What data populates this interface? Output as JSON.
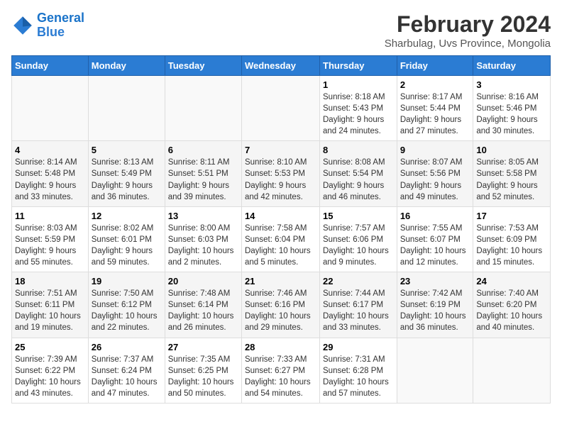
{
  "header": {
    "logo_line1": "General",
    "logo_line2": "Blue",
    "month_year": "February 2024",
    "location": "Sharbulag, Uvs Province, Mongolia"
  },
  "days_of_week": [
    "Sunday",
    "Monday",
    "Tuesday",
    "Wednesday",
    "Thursday",
    "Friday",
    "Saturday"
  ],
  "weeks": [
    [
      {
        "day": "",
        "info": ""
      },
      {
        "day": "",
        "info": ""
      },
      {
        "day": "",
        "info": ""
      },
      {
        "day": "",
        "info": ""
      },
      {
        "day": "1",
        "sunrise": "8:18 AM",
        "sunset": "5:43 PM",
        "daylight": "9 hours and 24 minutes."
      },
      {
        "day": "2",
        "sunrise": "8:17 AM",
        "sunset": "5:44 PM",
        "daylight": "9 hours and 27 minutes."
      },
      {
        "day": "3",
        "sunrise": "8:16 AM",
        "sunset": "5:46 PM",
        "daylight": "9 hours and 30 minutes."
      }
    ],
    [
      {
        "day": "4",
        "sunrise": "8:14 AM",
        "sunset": "5:48 PM",
        "daylight": "9 hours and 33 minutes."
      },
      {
        "day": "5",
        "sunrise": "8:13 AM",
        "sunset": "5:49 PM",
        "daylight": "9 hours and 36 minutes."
      },
      {
        "day": "6",
        "sunrise": "8:11 AM",
        "sunset": "5:51 PM",
        "daylight": "9 hours and 39 minutes."
      },
      {
        "day": "7",
        "sunrise": "8:10 AM",
        "sunset": "5:53 PM",
        "daylight": "9 hours and 42 minutes."
      },
      {
        "day": "8",
        "sunrise": "8:08 AM",
        "sunset": "5:54 PM",
        "daylight": "9 hours and 46 minutes."
      },
      {
        "day": "9",
        "sunrise": "8:07 AM",
        "sunset": "5:56 PM",
        "daylight": "9 hours and 49 minutes."
      },
      {
        "day": "10",
        "sunrise": "8:05 AM",
        "sunset": "5:58 PM",
        "daylight": "9 hours and 52 minutes."
      }
    ],
    [
      {
        "day": "11",
        "sunrise": "8:03 AM",
        "sunset": "5:59 PM",
        "daylight": "9 hours and 55 minutes."
      },
      {
        "day": "12",
        "sunrise": "8:02 AM",
        "sunset": "6:01 PM",
        "daylight": "9 hours and 59 minutes."
      },
      {
        "day": "13",
        "sunrise": "8:00 AM",
        "sunset": "6:03 PM",
        "daylight": "10 hours and 2 minutes."
      },
      {
        "day": "14",
        "sunrise": "7:58 AM",
        "sunset": "6:04 PM",
        "daylight": "10 hours and 5 minutes."
      },
      {
        "day": "15",
        "sunrise": "7:57 AM",
        "sunset": "6:06 PM",
        "daylight": "10 hours and 9 minutes."
      },
      {
        "day": "16",
        "sunrise": "7:55 AM",
        "sunset": "6:07 PM",
        "daylight": "10 hours and 12 minutes."
      },
      {
        "day": "17",
        "sunrise": "7:53 AM",
        "sunset": "6:09 PM",
        "daylight": "10 hours and 15 minutes."
      }
    ],
    [
      {
        "day": "18",
        "sunrise": "7:51 AM",
        "sunset": "6:11 PM",
        "daylight": "10 hours and 19 minutes."
      },
      {
        "day": "19",
        "sunrise": "7:50 AM",
        "sunset": "6:12 PM",
        "daylight": "10 hours and 22 minutes."
      },
      {
        "day": "20",
        "sunrise": "7:48 AM",
        "sunset": "6:14 PM",
        "daylight": "10 hours and 26 minutes."
      },
      {
        "day": "21",
        "sunrise": "7:46 AM",
        "sunset": "6:16 PM",
        "daylight": "10 hours and 29 minutes."
      },
      {
        "day": "22",
        "sunrise": "7:44 AM",
        "sunset": "6:17 PM",
        "daylight": "10 hours and 33 minutes."
      },
      {
        "day": "23",
        "sunrise": "7:42 AM",
        "sunset": "6:19 PM",
        "daylight": "10 hours and 36 minutes."
      },
      {
        "day": "24",
        "sunrise": "7:40 AM",
        "sunset": "6:20 PM",
        "daylight": "10 hours and 40 minutes."
      }
    ],
    [
      {
        "day": "25",
        "sunrise": "7:39 AM",
        "sunset": "6:22 PM",
        "daylight": "10 hours and 43 minutes."
      },
      {
        "day": "26",
        "sunrise": "7:37 AM",
        "sunset": "6:24 PM",
        "daylight": "10 hours and 47 minutes."
      },
      {
        "day": "27",
        "sunrise": "7:35 AM",
        "sunset": "6:25 PM",
        "daylight": "10 hours and 50 minutes."
      },
      {
        "day": "28",
        "sunrise": "7:33 AM",
        "sunset": "6:27 PM",
        "daylight": "10 hours and 54 minutes."
      },
      {
        "day": "29",
        "sunrise": "7:31 AM",
        "sunset": "6:28 PM",
        "daylight": "10 hours and 57 minutes."
      },
      {
        "day": "",
        "info": ""
      },
      {
        "day": "",
        "info": ""
      }
    ]
  ]
}
